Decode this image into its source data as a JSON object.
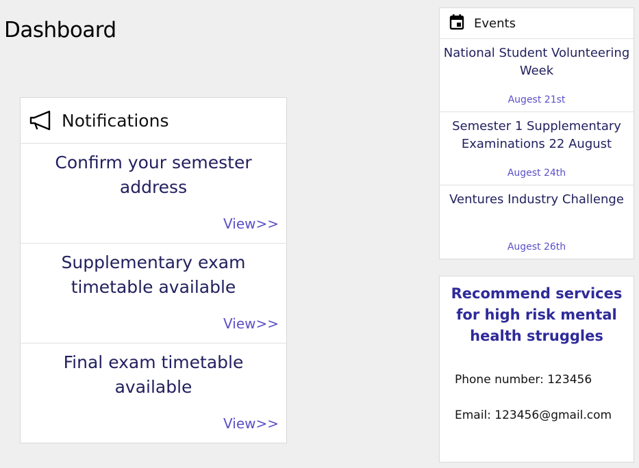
{
  "page": {
    "title": "Dashboard"
  },
  "notifications": {
    "title": "Notifications",
    "icon": "megaphone-icon",
    "items": [
      {
        "text": "Confirm your semester address",
        "view_label": "View>>"
      },
      {
        "text": "Supplementary exam timetable available",
        "view_label": "View>>"
      },
      {
        "text": "Final exam timetable available",
        "view_label": "View>>"
      }
    ]
  },
  "events": {
    "title": "Events",
    "icon": "calendar-icon",
    "items": [
      {
        "title": "National Student Volunteering Week",
        "date": "Augest 21st"
      },
      {
        "title": "Semester 1 Supplementary Examinations 22 August",
        "date": "Augest 24th"
      },
      {
        "title": "Ventures Industry Challenge",
        "date": "Augest 26th"
      }
    ]
  },
  "recommend": {
    "title": "Recommend services for high risk mental health struggles",
    "phone": "Phone number: 123456",
    "email": "Email: 123456@gmail.com"
  },
  "colors": {
    "background": "#efefef",
    "panel": "#ffffff",
    "text_dark": "#22205e",
    "link": "#5a4fc8",
    "accent_title": "#2e2a9a"
  }
}
